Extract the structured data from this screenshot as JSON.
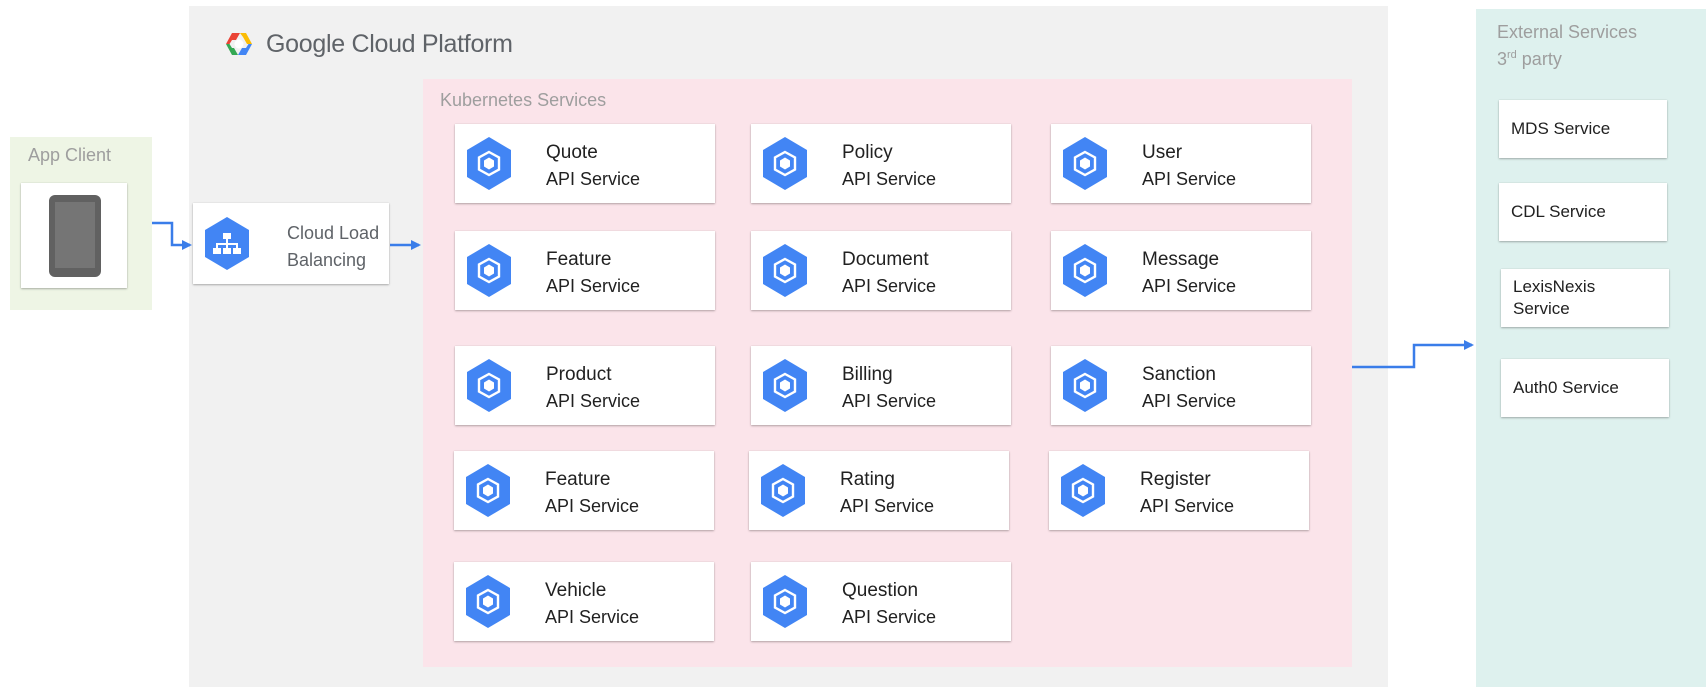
{
  "platform": {
    "logo_text": "Google Cloud Platform"
  },
  "kubernetes": {
    "label": "Kubernetes Services",
    "services": [
      {
        "name": "Quote",
        "sub": "API Service"
      },
      {
        "name": "Policy",
        "sub": "API Service"
      },
      {
        "name": "User",
        "sub": "API Service"
      },
      {
        "name": "Feature",
        "sub": "API Service"
      },
      {
        "name": "Document",
        "sub": "API Service"
      },
      {
        "name": "Message",
        "sub": "API Service"
      },
      {
        "name": "Product",
        "sub": "API Service"
      },
      {
        "name": "Billing",
        "sub": "API Service"
      },
      {
        "name": "Sanction",
        "sub": "API Service"
      },
      {
        "name": "Feature",
        "sub": "API Service"
      },
      {
        "name": "Rating",
        "sub": "API Service"
      },
      {
        "name": "Register",
        "sub": "API Service"
      },
      {
        "name": "Vehicle",
        "sub": "API Service"
      },
      {
        "name": "Question",
        "sub": "API Service"
      }
    ]
  },
  "client": {
    "label": "App Client"
  },
  "load_balancer": {
    "line1": "Cloud Load",
    "line2": "Balancing"
  },
  "external": {
    "label": "External Services",
    "sublabel_prefix": "3",
    "sublabel_sup": "rd",
    "sublabel_suffix": " party",
    "services": [
      {
        "line1": "MDS Service",
        "line2": ""
      },
      {
        "line1": "CDL Service",
        "line2": ""
      },
      {
        "line1": "LexisNexis",
        "line2": "Service"
      },
      {
        "line1": "Auth0 Service",
        "line2": ""
      }
    ]
  },
  "colors": {
    "gcp_bg": "#f1f1f1",
    "kubernetes_bg": "#fbe4ea",
    "client_bg": "#eef5e5",
    "external_bg": "#def1ee",
    "icon_blue": "#4285f4",
    "arrow_blue": "#3a7de9"
  },
  "icons": {
    "service": "kubernetes-engine-icon",
    "load_balancer": "cloud-load-balancing-icon",
    "client": "mobile-device-icon",
    "logo": "google-cloud-logo-icon"
  }
}
